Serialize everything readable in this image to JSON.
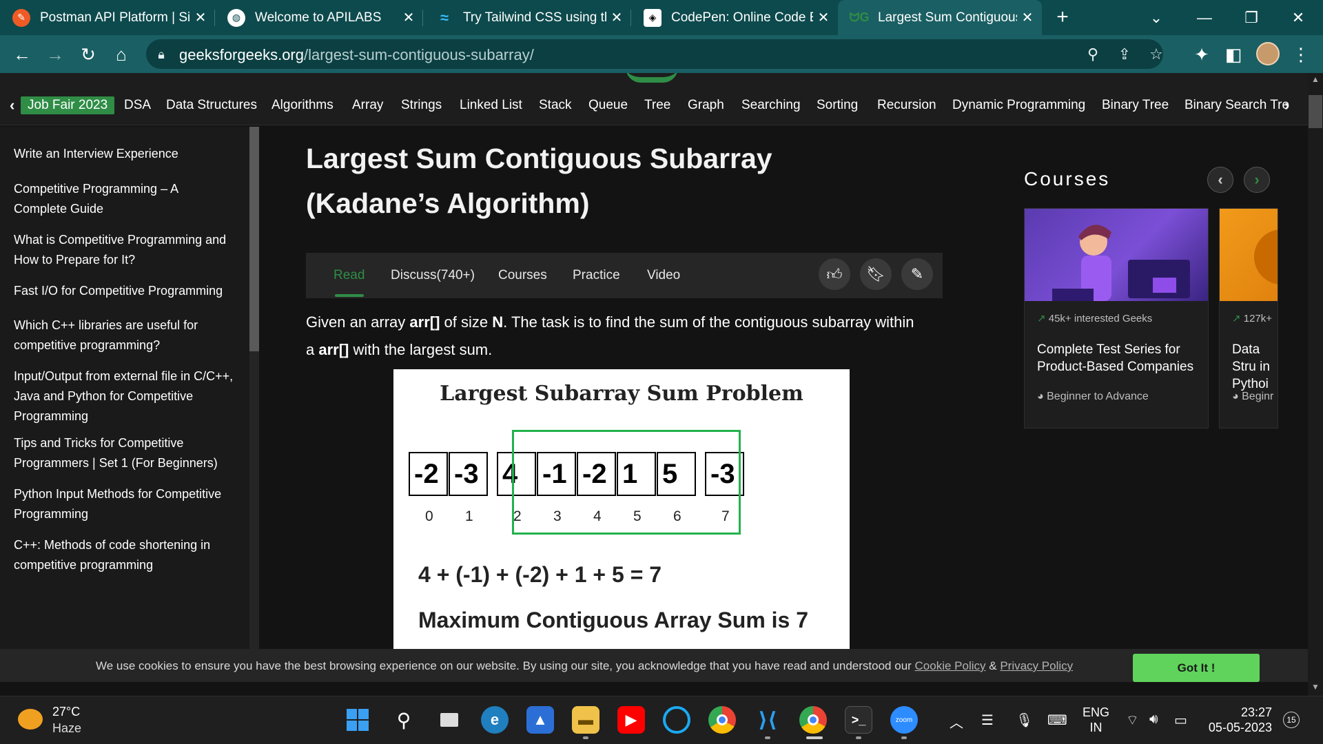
{
  "browser": {
    "tabs": [
      {
        "title": "Postman API Platform | Si",
        "favicon": "postman-icon",
        "color": "#ef5b25",
        "active": false
      },
      {
        "title": "Welcome to APILABS",
        "favicon": "globe-icon",
        "color": "#ffffff",
        "active": false
      },
      {
        "title": "Try Tailwind CSS using the",
        "favicon": "tailwind-icon",
        "color": "#38bdf8",
        "active": false
      },
      {
        "title": "CodePen: Online Code Ed",
        "favicon": "codepen-icon",
        "color": "#ffffff",
        "active": false
      },
      {
        "title": "Largest Sum Contiguous S",
        "favicon": "gfg-icon",
        "color": "#2f8d46",
        "active": true
      }
    ],
    "close_glyph": "✕",
    "new_tab_glyph": "+",
    "window_controls": {
      "dropdown": "⌄",
      "minimize": "—",
      "restore": "❐",
      "close": "✕"
    },
    "url_host": "geeksforgeeks.org",
    "url_path": "/largest-sum-contiguous-subarray/"
  },
  "topnav": {
    "items": [
      "Job Fair 2023",
      "DSA",
      "Data Structures",
      "Algorithms",
      "Array",
      "Strings",
      "Linked List",
      "Stack",
      "Queue",
      "Tree",
      "Graph",
      "Searching",
      "Sorting",
      "Recursion",
      "Dynamic Programming",
      "Binary Tree",
      "Binary Search Tre"
    ],
    "left_arrow": "‹",
    "right_arrow": "›"
  },
  "sidebar": {
    "items": [
      "Write an Interview Experience",
      "Competitive Programming – A Complete Guide",
      "What is Competitive Programming and How to Prepare for It?",
      "Fast I/O for Competitive Programming",
      "Which C++ libraries are useful for competitive programming?",
      "Input/Output from external file in C/C++, Java and Python for Competitive Programming",
      "Tips and Tricks for Competitive Programmers | Set 1 (For Beginners)",
      "Python Input Methods for Competitive Programming",
      "C++: Methods of code shortening in competitive programming"
    ]
  },
  "article": {
    "title": "Largest Sum Contiguous Subarray (Kadane’s Algorithm)",
    "tabs": [
      "Read",
      "Discuss(740+)",
      "Courses",
      "Practice",
      "Video"
    ],
    "desc_1": "Given an array ",
    "desc_arr1": "arr[]",
    "desc_2": " of size ",
    "desc_n": "N",
    "desc_3": ". The task is to find the sum of the contiguous subarray within a ",
    "desc_arr2": "arr[]",
    "desc_4": " with the largest sum.",
    "figure": {
      "title": "Largest  Subarray  Sum  Problem",
      "values": [
        "-2",
        "-3",
        "4",
        "-1",
        "-2",
        "1",
        "5",
        "-3"
      ],
      "indices": [
        "0",
        "1",
        "2",
        "3",
        "4",
        "5",
        "6",
        "7"
      ],
      "highlight_range": [
        2,
        6
      ],
      "highlight_color": "#22b24c",
      "equation": "4 + (-1) + (-2) + 1 + 5 = 7",
      "result": "Maximum Contiguous Array Sum is 7"
    }
  },
  "courses": {
    "heading": "Courses",
    "prev_glyph": "‹",
    "next_glyph": "›",
    "cards": [
      {
        "interest": "45k+ interested Geeks",
        "title": "Complete Test Series for Product-Based Companies",
        "level": "Beginner to Advance"
      },
      {
        "interest": "127k+",
        "title": "Data Stru in Pythoi",
        "level": "Beginr"
      }
    ]
  },
  "cookie": {
    "text": "We use cookies to ensure you have the best browsing experience on our website. By using our site, you acknowledge that you have read and understood our ",
    "cookie_policy": "Cookie Policy",
    "amp": " & ",
    "privacy_policy": "Privacy Policy",
    "button": "Got It !"
  },
  "taskbar": {
    "temperature": "27°C",
    "condition": "Haze",
    "language": "ENG",
    "region": "IN",
    "time": "23:27",
    "date": "05-05-2023",
    "notifications": "15",
    "zoom_label": "zoom"
  },
  "colors": {
    "accent": "#2f8d46",
    "cookie_button": "#5fd35b",
    "tab_strip": "#0d4a4d",
    "toolbar": "#1a5f63"
  }
}
